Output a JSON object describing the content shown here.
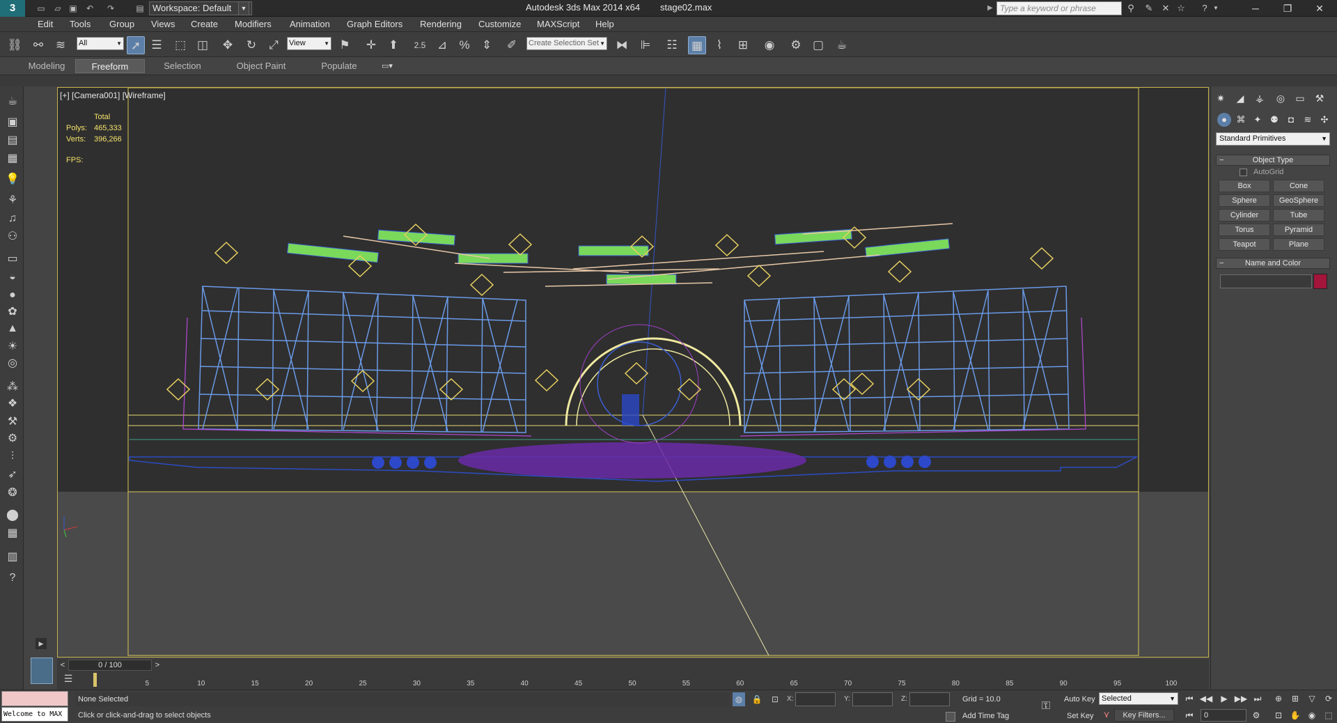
{
  "titlebar": {
    "workspace": "Workspace: Default",
    "app_title": "Autodesk 3ds Max  2014 x64",
    "file_title": "stage02.max",
    "search_placeholder": "Type a keyword or phrase"
  },
  "menu": [
    "Edit",
    "Tools",
    "Group",
    "Views",
    "Create",
    "Modifiers",
    "Animation",
    "Graph Editors",
    "Rendering",
    "Customize",
    "MAXScript",
    "Help"
  ],
  "toolbar": {
    "selection_filter": "All",
    "ref_coord": "View",
    "snap_value": "2.5",
    "named_selection_placeholder": "Create Selection Set"
  },
  "ribbon": {
    "tabs": [
      "Modeling",
      "Freeform",
      "Selection",
      "Object Paint",
      "Populate"
    ],
    "active_tab": "Freeform"
  },
  "viewport": {
    "label": "[+] [Camera001] [Wireframe]",
    "stats": {
      "header": "Total",
      "polys_label": "Polys:",
      "polys": "465,333",
      "verts_label": "Verts:",
      "verts": "396,266"
    },
    "fps_label": "FPS:"
  },
  "timeline": {
    "prev": "<",
    "frame_display": "0 / 100",
    "next": ">",
    "ticks": [
      "5",
      "10",
      "15",
      "20",
      "25",
      "30",
      "35",
      "40",
      "45",
      "50",
      "55",
      "60",
      "65",
      "70",
      "75",
      "80",
      "85",
      "90",
      "95",
      "100"
    ]
  },
  "command_panel": {
    "category": "Standard Primitives",
    "object_type_title": "Object Type",
    "autogrid": "AutoGrid",
    "primitives": [
      "Box",
      "Cone",
      "Sphere",
      "GeoSphere",
      "Cylinder",
      "Tube",
      "Torus",
      "Pyramid",
      "Teapot",
      "Plane"
    ],
    "name_color_title": "Name and Color",
    "color": "#a3153b"
  },
  "status": {
    "listener": "Welcome to MAX",
    "selection": "None Selected",
    "prompt": "Click or click-and-drag to select objects",
    "x_label": "X:",
    "y_label": "Y:",
    "z_label": "Z:",
    "grid": "Grid = 10.0",
    "add_time_tag": "Add Time Tag",
    "auto_key": "Auto Key",
    "set_key": "Set Key",
    "key_mode": "Selected",
    "key_filters": "Key Filters...",
    "current_frame": "0"
  },
  "colors": {
    "viewport_border": "#c8b24b",
    "active_blue": "#5c7fa8",
    "stats_yellow": "#f5e26a"
  }
}
